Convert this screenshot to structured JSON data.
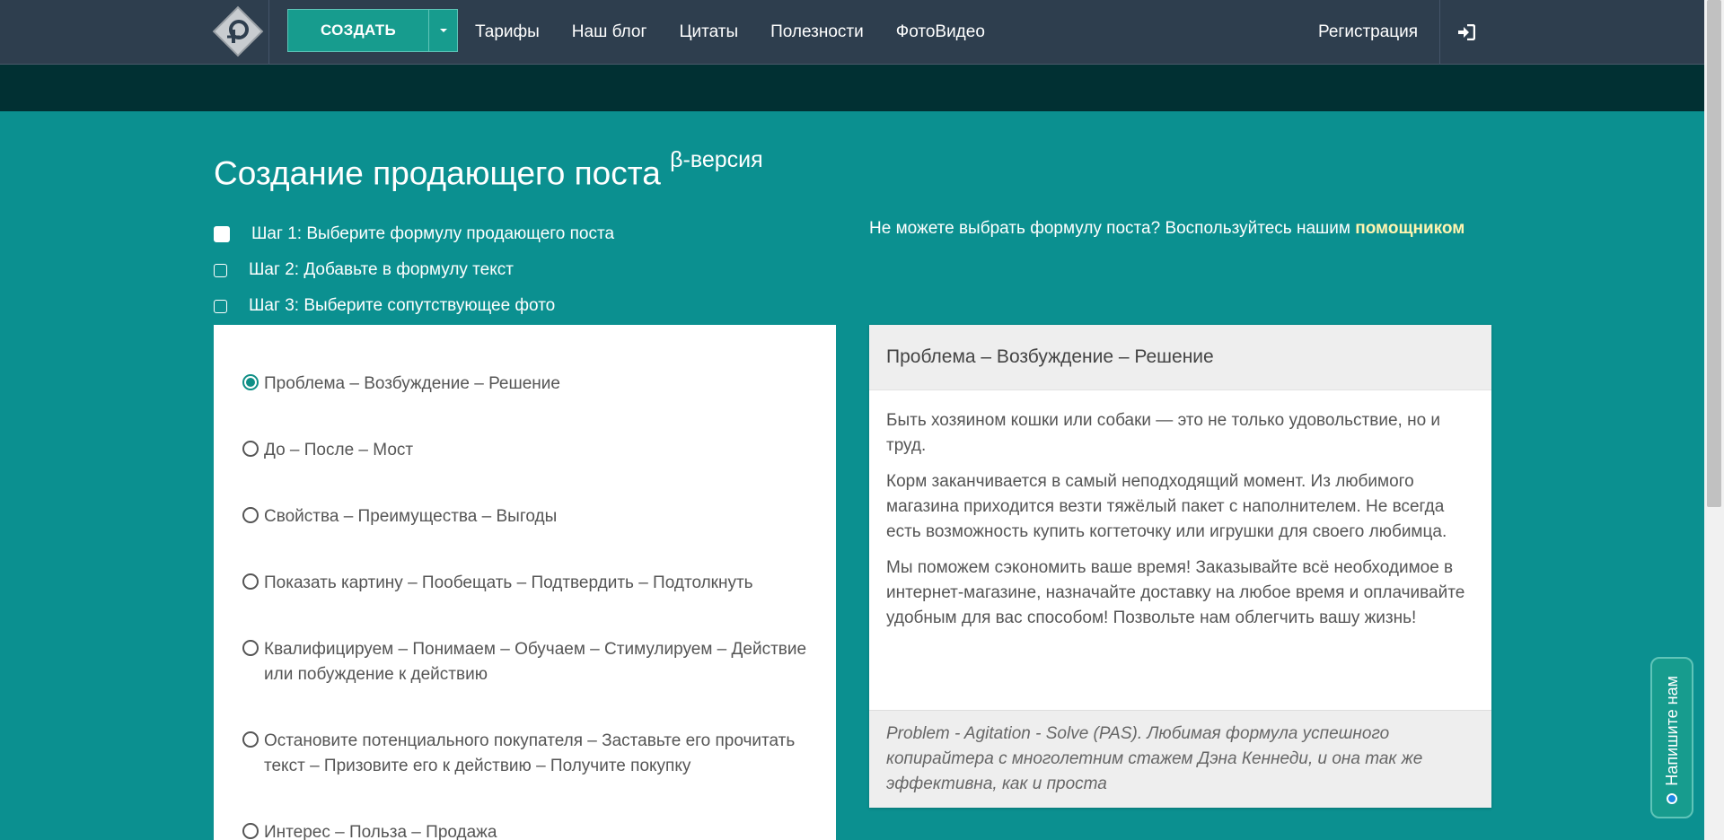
{
  "nav": {
    "create_label": "СОЗДАТЬ",
    "links": [
      "Тарифы",
      "Наш блог",
      "Цитаты",
      "Полезности",
      "ФотоВидео"
    ],
    "register": "Регистрация"
  },
  "page": {
    "title": "Создание продающего поста",
    "beta": "β-версия"
  },
  "steps": [
    "Шаг 1: Выберите формулу продающего поста",
    "Шаг 2: Добавьте в формулу текст",
    "Шаг 3: Выберите сопутствующее фото"
  ],
  "helper": {
    "text": "Не можете выбрать формулу поста? Воспользуйтесь нашим",
    "link": "помощником"
  },
  "formulas": [
    {
      "label": "Проблема – Возбуждение – Решение",
      "selected": true
    },
    {
      "label": "До – После – Мост",
      "selected": false
    },
    {
      "label": "Свойства – Преимущества – Выгоды",
      "selected": false
    },
    {
      "label": "Показать картину – Пообещать – Подтвердить – Подтолкнуть",
      "selected": false
    },
    {
      "label": "Квалифицируем – Понимаем – Обучаем – Стимулируем – Действие или побуждение к действию",
      "selected": false
    },
    {
      "label": "Остановите потенциального покупателя – Заставьте его прочитать текст – Призовите его к действию – Получите покупку",
      "selected": false
    },
    {
      "label": "Интерес – Польза – Продажа",
      "selected": false
    }
  ],
  "preview": {
    "title": "Проблема – Возбуждение – Решение",
    "paragraphs": [
      "Быть хозяином кошки или собаки — это не только удовольствие, но и труд.",
      "Корм заканчивается в самый неподходящий момент. Из любимого магазина приходится везти тяжёлый пакет с наполнителем. Не всегда есть возможность купить когтеточку или игрушки для своего любимца.",
      "Мы поможем сэкономить ваше время! Заказывайте всё необходимое в интернет-магазине, назначайте доставку на любое время и оплачивайте удобным для вас способом! Позвольте нам облегчить вашу жизнь!"
    ],
    "footer": "Problem - Agitation - Solve (PAS). Любимая формула успешного копирайтера с многолетним стажем Дэна Кеннеди, и она так же эффективна, как и проста"
  },
  "feedback": {
    "label": "Напишите нам"
  },
  "icons": {
    "logo": "logo-icon",
    "caret": "caret-down-icon",
    "login": "sign-in-icon"
  }
}
